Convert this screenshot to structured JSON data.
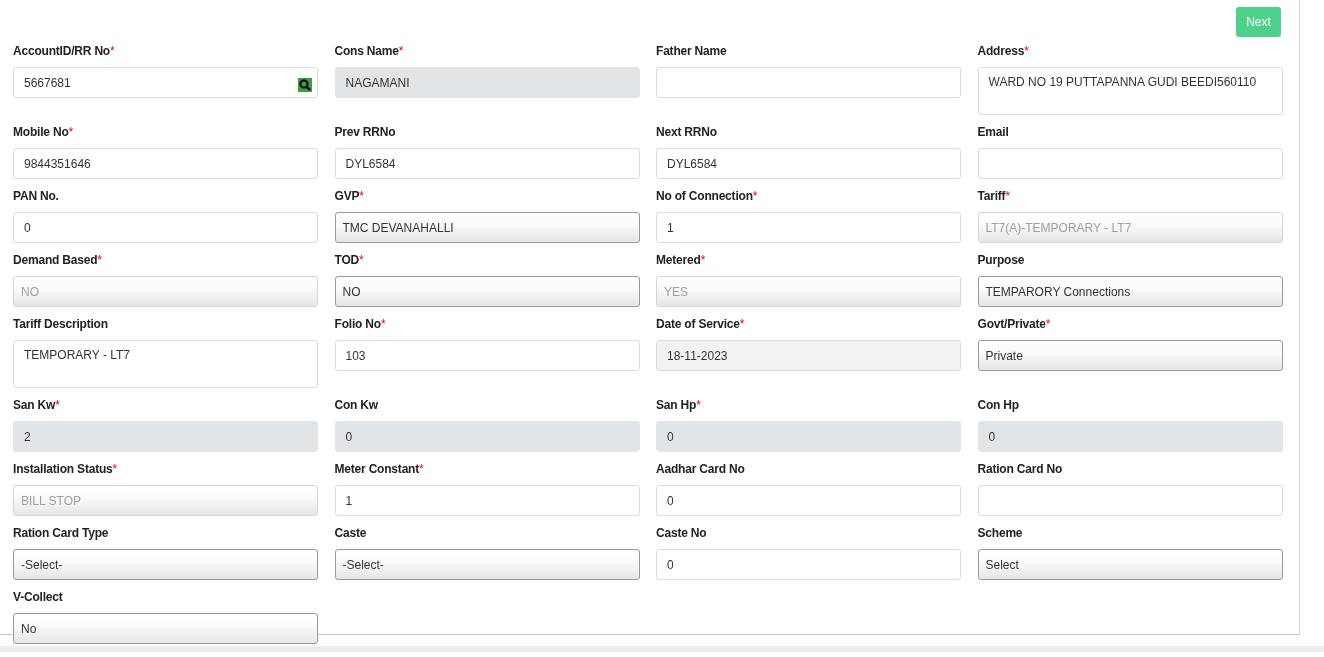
{
  "next_button": {
    "label": "Next"
  },
  "rows": [
    {
      "fields": [
        {
          "label": "AccountID/RR No",
          "asterisk": "*",
          "kind": "search",
          "value": "5667681"
        },
        {
          "label": "Cons Name",
          "asterisk": "*",
          "kind": "readonly",
          "value": "NAGAMANI"
        },
        {
          "label": "Father Name",
          "kind": "text"
        },
        {
          "label": "Address",
          "asterisk": "*",
          "kind": "textarea",
          "value": "WARD NO 19 PUTTAPANNA GUDI BEEDI560110"
        }
      ]
    },
    {
      "fields": [
        {
          "label": "Mobile No",
          "asterisk": "*",
          "kind": "text",
          "value": "9844351646"
        },
        {
          "label": "Prev RRNo",
          "kind": "text",
          "value": "DYL6584"
        },
        {
          "label": "Next RRNo",
          "kind": "text",
          "value": "DYL6584"
        },
        {
          "label": "Email",
          "kind": "text"
        }
      ]
    },
    {
      "fields": [
        {
          "label": "PAN No.",
          "kind": "text",
          "value": "0"
        },
        {
          "label": "GVP",
          "asterisk": "*",
          "kind": "select",
          "value": "TMC DEVANAHALLI",
          "disabled": false
        },
        {
          "label": "No of Connection",
          "asterisk": "*",
          "kind": "text",
          "value": "1"
        },
        {
          "label": "Tariff",
          "asterisk": "*",
          "kind": "select",
          "value": "LT7(A)-TEMPORARY - LT7",
          "disabled": true
        }
      ]
    },
    {
      "fields": [
        {
          "label": "Demand Based",
          "asterisk": "*",
          "kind": "select",
          "value": "NO",
          "disabled": true
        },
        {
          "label": "TOD",
          "asterisk": "*",
          "kind": "select",
          "value": "NO",
          "disabled": false
        },
        {
          "label": "Metered",
          "asterisk": "*",
          "kind": "select",
          "value": "YES",
          "disabled": true
        },
        {
          "label": "Purpose",
          "kind": "select",
          "value": "TEMPARORY Connections",
          "disabled": false
        }
      ]
    },
    {
      "fields": [
        {
          "label": "Tariff Description",
          "kind": "textarea",
          "value": "TEMPORARY - LT7"
        },
        {
          "label": "Folio No",
          "asterisk": "*",
          "kind": "text",
          "value": "103"
        },
        {
          "label": "Date of Service",
          "asterisk": "*",
          "kind": "date",
          "value": "18-11-2023"
        },
        {
          "label": "Govt/Private",
          "asterisk": "*",
          "kind": "select",
          "value": "Private",
          "disabled": false
        }
      ]
    },
    {
      "fields": [
        {
          "label": "San Kw",
          "asterisk": "*",
          "kind": "readonly",
          "value": "2"
        },
        {
          "label": "Con Kw",
          "kind": "readonly",
          "value": "0"
        },
        {
          "label": "San Hp",
          "asterisk": "*",
          "kind": "readonly",
          "value": "0"
        },
        {
          "label": "Con Hp",
          "kind": "readonly",
          "value": "0"
        }
      ]
    },
    {
      "fields": [
        {
          "label": "Installation Status",
          "asterisk": "*",
          "kind": "select",
          "value": "BILL STOP",
          "disabled": true
        },
        {
          "label": "Meter Constant",
          "asterisk": "*",
          "kind": "text",
          "value": "1"
        },
        {
          "label": "Aadhar Card No",
          "kind": "text",
          "value": "0"
        },
        {
          "label": "Ration Card No",
          "kind": "text"
        }
      ]
    },
    {
      "fields": [
        {
          "label": "Ration Card Type",
          "kind": "select",
          "value": "-Select-",
          "disabled": false
        },
        {
          "label": "Caste",
          "kind": "select",
          "value": "-Select-",
          "disabled": false
        },
        {
          "label": "Caste No",
          "kind": "text",
          "value": "0"
        },
        {
          "label": "Scheme",
          "kind": "select",
          "value": "Select",
          "disabled": false
        }
      ]
    },
    {
      "fields": [
        {
          "label": "V-Collect",
          "kind": "select",
          "value": "No",
          "disabled": false
        }
      ]
    }
  ]
}
